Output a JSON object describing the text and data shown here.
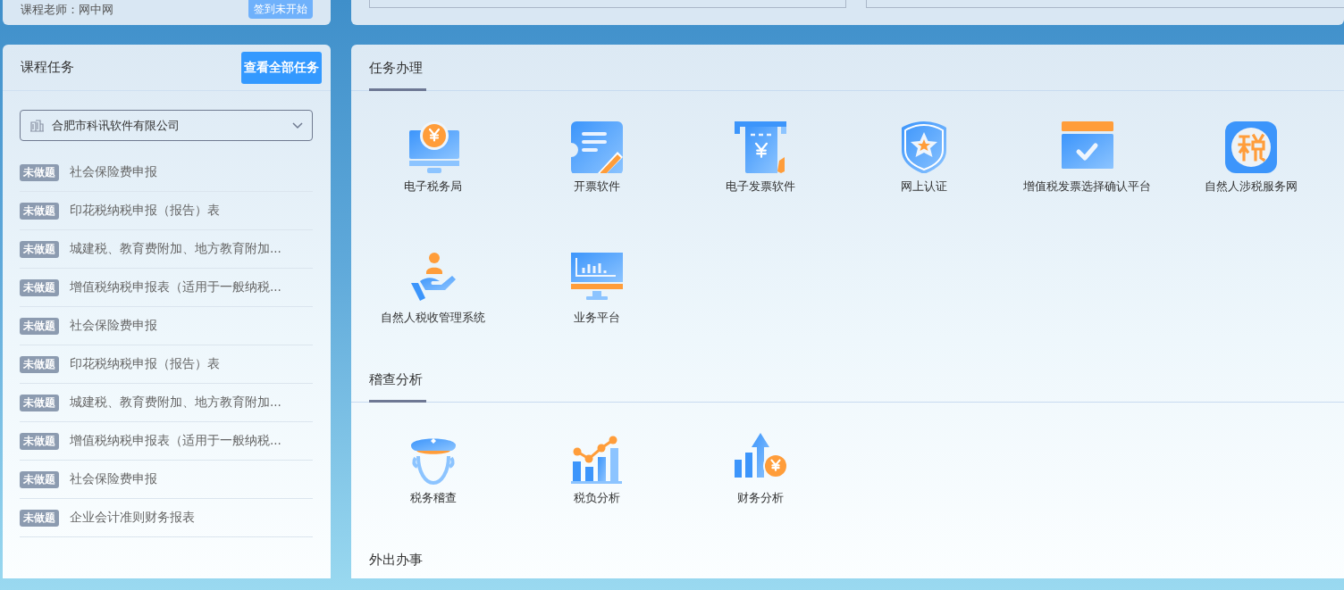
{
  "course": {
    "teacher": "课程老师：网中网",
    "checkin_button": "签到未开始"
  },
  "tasks": {
    "title": "课程任务",
    "view_all_button": "查看全部任务",
    "company_select": {
      "value": "合肥市科讯软件有限公司"
    },
    "items": [
      {
        "status": "未做题",
        "name": "社会保险费申报"
      },
      {
        "status": "未做题",
        "name": "印花税纳税申报（报告）表"
      },
      {
        "status": "未做题",
        "name": "城建税、教育费附加、地方教育附加..."
      },
      {
        "status": "未做题",
        "name": "增值税纳税申报表（适用于一般纳税..."
      },
      {
        "status": "未做题",
        "name": "社会保险费申报"
      },
      {
        "status": "未做题",
        "name": "印花税纳税申报（报告）表"
      },
      {
        "status": "未做题",
        "name": "城建税、教育费附加、地方教育附加..."
      },
      {
        "status": "未做题",
        "name": "增值税纳税申报表（适用于一般纳税..."
      },
      {
        "status": "未做题",
        "name": "社会保险费申报"
      },
      {
        "status": "未做题",
        "name": "企业会计准则财务报表"
      }
    ]
  },
  "sections": [
    {
      "title": "任务办理",
      "apps": [
        {
          "name": "电子税务局",
          "kind": "monitor-coin"
        },
        {
          "name": "开票软件",
          "kind": "ticket-pencil"
        },
        {
          "name": "电子发票软件",
          "kind": "receipt"
        },
        {
          "name": "网上认证",
          "kind": "shield-star"
        },
        {
          "name": "增值税发票选择确认平台",
          "kind": "check-window"
        },
        {
          "name": "自然人涉税服务网",
          "kind": "seal"
        },
        {
          "name": "自然人税收管理系统",
          "kind": "hand-person"
        },
        {
          "name": "业务平台",
          "kind": "monitor-chart"
        }
      ]
    },
    {
      "title": "稽查分析",
      "apps": [
        {
          "name": "税务稽查",
          "kind": "officer"
        },
        {
          "name": "税负分析",
          "kind": "chart"
        },
        {
          "name": "财务分析",
          "kind": "growth-coin"
        }
      ]
    },
    {
      "title": "外出办事"
    }
  ]
}
